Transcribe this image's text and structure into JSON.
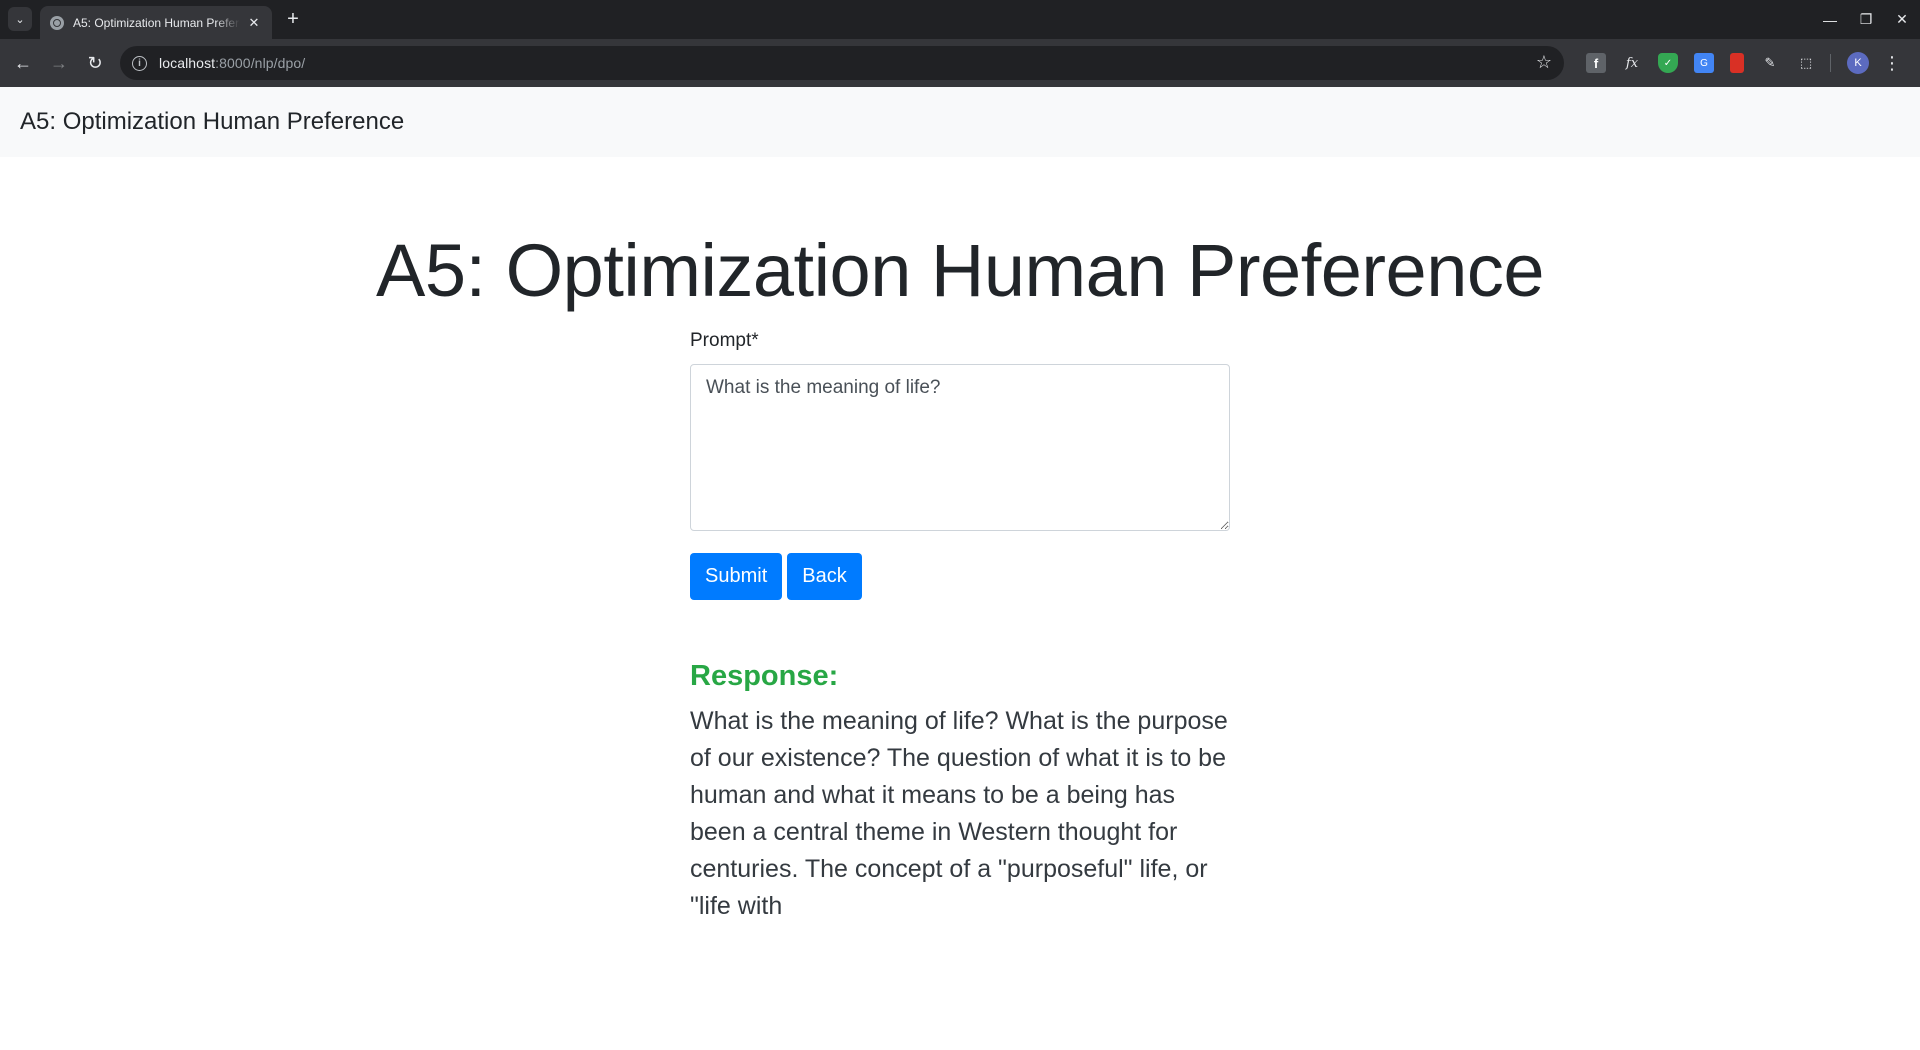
{
  "browser": {
    "tab_title": "A5: Optimization Human Preference",
    "url_host": "localhost",
    "url_path": ":8000/nlp/dpo/",
    "profile_initial": "K"
  },
  "navbar": {
    "brand": "A5: Optimization Human Preference"
  },
  "main": {
    "title": "A5: Optimization Human Preference",
    "prompt_label": "Prompt*",
    "prompt_value": "What is the meaning of life?",
    "submit_label": "Submit",
    "back_label": "Back",
    "response_heading": "Response:",
    "response_text": "What is the meaning of life? What is the purpose of our existence? The question of what it is to be human and what it means to be a being has been a central theme in Western thought for centuries. The concept of a \"purposeful\" life, or \"life with"
  },
  "colors": {
    "primary": "#007bff",
    "success": "#28a745",
    "navbar_bg": "#f8f9fa"
  }
}
